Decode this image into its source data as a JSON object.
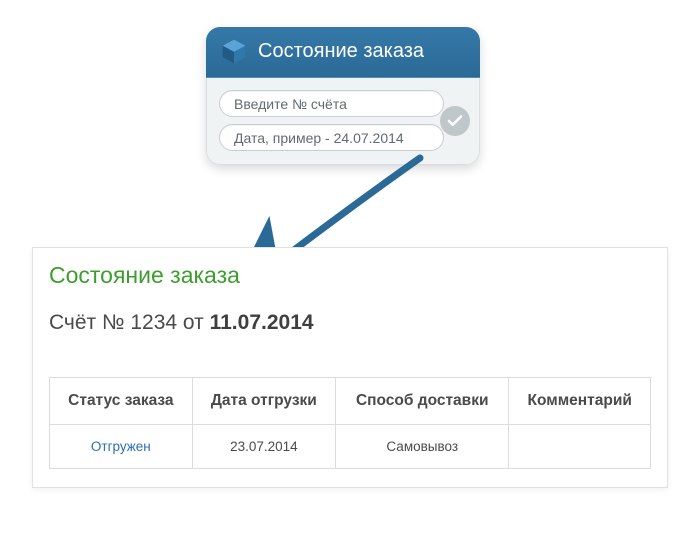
{
  "widget": {
    "title": "Состояние заказа",
    "account_placeholder": "Введите № счёта",
    "date_placeholder": "Дата, пример - 24.07.2014"
  },
  "panel": {
    "title": "Состояние заказа",
    "invoice_prefix": "Счёт № ",
    "invoice_number": "1234",
    "invoice_sep": " от ",
    "invoice_date": "11.07.2014"
  },
  "table": {
    "headers": {
      "status": "Статус заказа",
      "ship_date": "Дата отгрузки",
      "delivery": "Способ доставки",
      "comment": "Комментарий"
    },
    "row": {
      "status": "Отгружен",
      "ship_date": "23.07.2014",
      "delivery": "Самовывоз",
      "comment": ""
    }
  }
}
